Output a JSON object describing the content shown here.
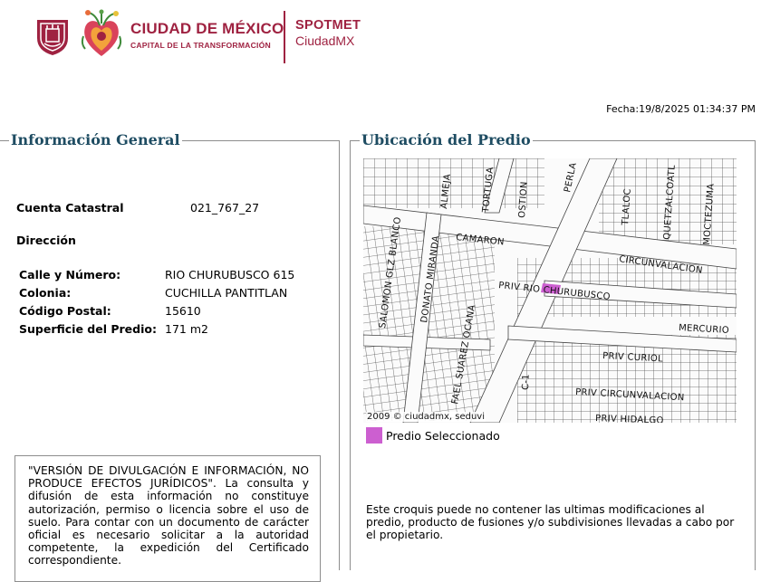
{
  "header": {
    "brand_main": "CIUDAD DE MÉXICO",
    "brand_sub": "CAPITAL DE LA TRANSFORMACIÓN",
    "app_title": "SPOTMET",
    "app_subtitle": "CiudadMX",
    "accent_color": "#9f2241"
  },
  "fecha": "Fecha:19/8/2025 01:34:37 PM",
  "info": {
    "title": "Información General",
    "cuenta_label": "Cuenta Catastral",
    "cuenta_value": "021_767_27",
    "direccion_label": "Dirección",
    "fields": [
      {
        "label": "Calle y Número:",
        "value": "RIO CHURUBUSCO 615"
      },
      {
        "label": "Colonia:",
        "value": "CUCHILLA PANTITLAN"
      },
      {
        "label": "Código Postal:",
        "value": "15610"
      },
      {
        "label": "Superficie del Predio:",
        "value": "171 m2"
      }
    ]
  },
  "disclaimer": "\"VERSIÓN DE DIVULGACIÓN E INFORMACIÓN, NO PRODUCE EFECTOS JURÍDICOS\". La consulta y difusión de esta información no constituye autorización, permiso o licencia sobre el uso de suelo. Para contar con un documento de carácter oficial es necesario solicitar a la autoridad competente, la expedición del Certificado correspondiente.",
  "ubicacion": {
    "title": "Ubicación del Predio",
    "map_credit": "2009 © ciudadmx, seduvi",
    "legend_label": "Predio Seleccionado",
    "selected_color": "#cc5fd0",
    "note": "Este croquis puede no contener las ultimas modificaciones al predio, producto de fusiones y/o subdivisiones llevadas a cabo por el propietario.",
    "streets": {
      "salomon": "SALOMON GLZ BLANCO",
      "donato": "DONATO MIRANDA",
      "fael": "FAEL SUAREZ OCANA",
      "almeja": "ALMEJA",
      "tortuga": "TORTUGA",
      "ostion": "OSTION",
      "perla": "PERLA",
      "tlaloc": "TLALOC",
      "quetzalcoatl": "QUETZALCOATL",
      "moctezuma": "MOCTEZUMA",
      "camaron": "CAMARON",
      "circunvalacion": "CIRCUNVALACION",
      "priv_rio": "PRIV RIO CHURUBUSCO",
      "mercurio": "MERCURIO",
      "priv_curiol": "PRIV CURIOL",
      "priv_circ": "PRIV CIRCUNVALACION",
      "priv_hidalgo": "PRIV HIDALGO",
      "c1": "C-1"
    }
  }
}
